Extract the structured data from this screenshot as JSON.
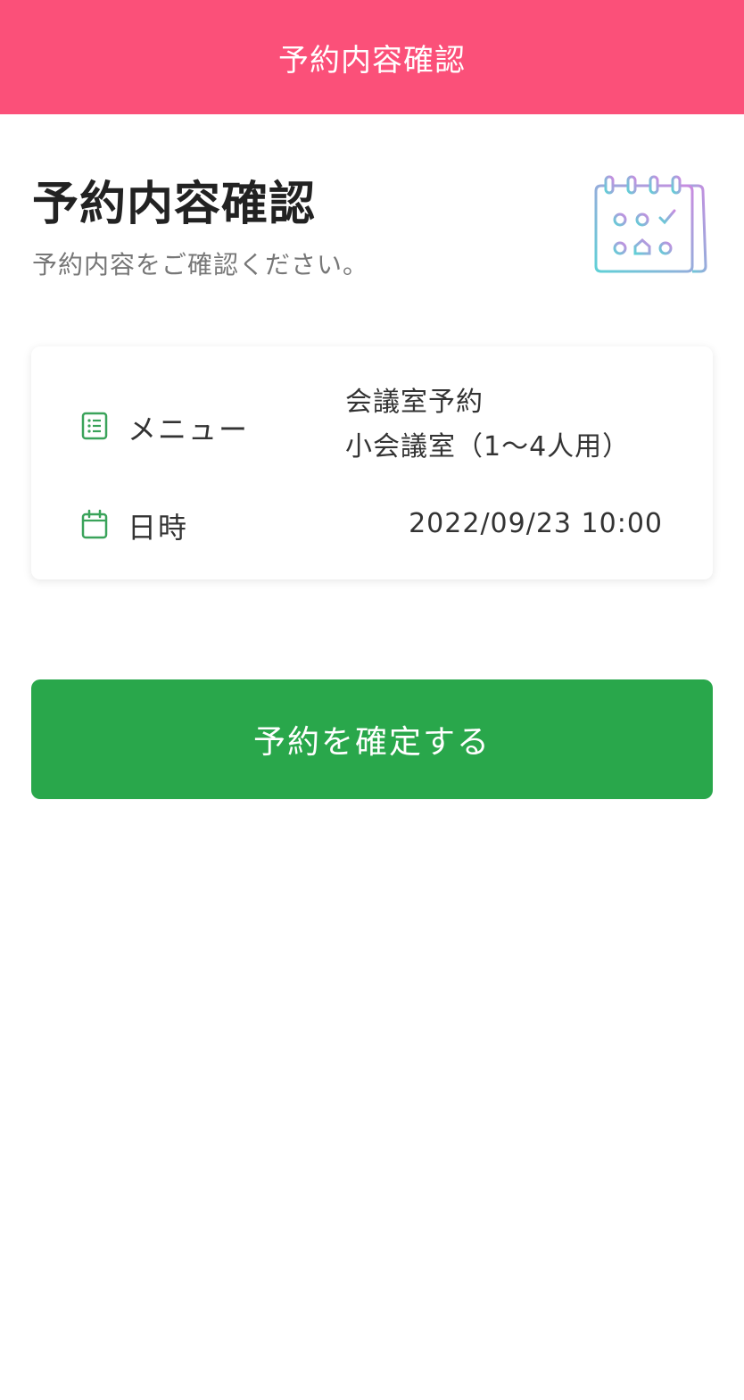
{
  "header": {
    "title": "予約内容確認"
  },
  "page": {
    "title": "予約内容確認",
    "subtitle": "予約内容をご確認ください。"
  },
  "details": {
    "menu": {
      "label": "メニュー",
      "value_line1": "会議室予約",
      "value_line2": "小会議室（1〜4人用）",
      "icon": "list-icon"
    },
    "datetime": {
      "label": "日時",
      "value": "2022/09/23 10:00",
      "icon": "calendar-icon"
    }
  },
  "actions": {
    "confirm_label": "予約を確定する"
  },
  "colors": {
    "header": "#fb5079",
    "accent_green": "#29a74b",
    "icon_green": "#3aa35a"
  }
}
